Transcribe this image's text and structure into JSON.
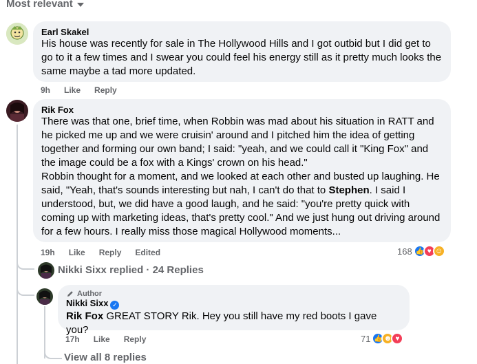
{
  "sort": {
    "label": "Most relevant"
  },
  "comments": [
    {
      "author": "Earl Skakel",
      "text": "His house was recently for sale in The Hollywood Hills and I got outbid but I did get to go to it a few times and I swear you could feel his energy still as it pretty much looks the same maybe a tad more updated.",
      "time": "9h",
      "like": "Like",
      "reply": "Reply"
    },
    {
      "author": "Rik Fox",
      "p1": "There was that one, brief time, when Robbin was mad about his situation in RATT and he picked me up and we were cruisin' around and I pitched him the idea of getting together and forming our own band; I said: \"yeah, and we could call it \"King Fox\" and the image could be a fox with a Kings' crown on his head.\"",
      "p2a": "Robbin thought for a moment, and we looked at each other and busted up laughing. He said, \"Yeah, that's sounds interesting but nah, I can't do that to ",
      "p2b": "Stephen",
      "p2c": ". I said I understood, but, we did have a good laugh, and he said: \"you're pretty quick with coming up with marketing ideas, that's pretty cool.\" And we just hung out driving around for a few hours. I really miss those magical Hollywood moments...",
      "time": "19h",
      "like": "Like",
      "reply": "Reply",
      "edited": "Edited",
      "reaction_count": "168"
    }
  ],
  "replies_summary": {
    "name": "Nikki Sixx",
    "text": "replied · 24 Replies"
  },
  "reply": {
    "author_tag": "Author",
    "author": "Nikki Sixx",
    "mention": "Rik Fox",
    "text": " GREAT STORY Rik. Hey you still have my red boots I gave you?",
    "time": "17h",
    "like": "Like",
    "reply": "Reply",
    "reaction_count": "71"
  },
  "view_all": "View all 8 replies",
  "colors": {
    "like": "#1877f2",
    "love": "#f33e58",
    "haha": "#f7b125",
    "secondary": "#65676b",
    "bubble": "#f0f2f5"
  }
}
